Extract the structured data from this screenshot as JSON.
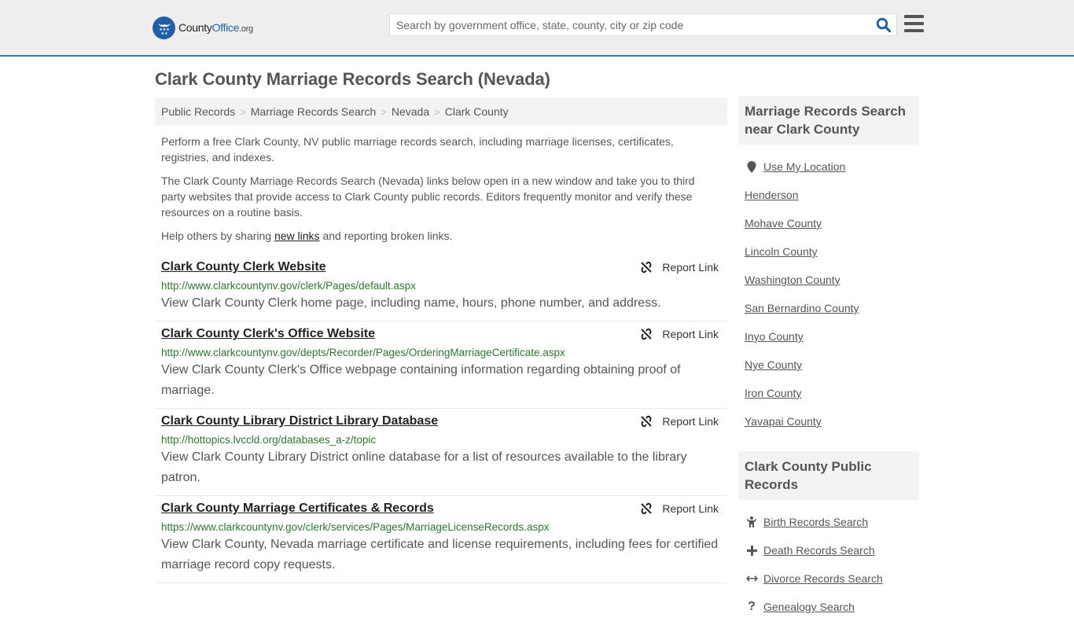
{
  "header": {
    "logo": {
      "name": "County",
      "name_bold": "Office",
      "tld": ".org"
    },
    "search": {
      "placeholder": "Search by government office, state, county, city or zip code",
      "value": ""
    },
    "brand_color": "#1f5fa8",
    "border_color": "#357ab7"
  },
  "page": {
    "title": "Clark County Marriage Records Search (Nevada)",
    "breadcrumb": [
      "Public Records",
      "Marriage Records Search",
      "Nevada",
      "Clark County"
    ],
    "breadcrumb_sep": ">",
    "intro": {
      "p1": "Perform a free Clark County, NV public marriage records search, including marriage licenses, certificates, registries, and indexes.",
      "p2": "The Clark County Marriage Records Search (Nevada) links below open in a new window and take you to third party websites that provide access to Clark County public records. Editors frequently monitor and verify these resources on a routine basis.",
      "p3_before": "Help others by sharing ",
      "p3_link": "new links",
      "p3_after": " and reporting broken links."
    }
  },
  "results": [
    {
      "title": "Clark County Clerk Website",
      "url": "http://www.clarkcountynv.gov/clerk/Pages/default.aspx",
      "description": "View Clark County Clerk home page, including name, hours, phone number, and address.",
      "report_label": "Report Link"
    },
    {
      "title": "Clark County Clerk's Office Website",
      "url": "http://www.clarkcountynv.gov/depts/Recorder/Pages/OrderingMarriageCertificate.aspx",
      "description": "View Clark County Clerk's Office webpage containing information regarding obtaining proof of marriage.",
      "report_label": "Report Link"
    },
    {
      "title": "Clark County Library District Library Database",
      "url": "http://hottopics.lvccld.org/databases_a-z/topic",
      "description": "View Clark County Library District online database for a list of resources available to the library patron.",
      "report_label": "Report Link"
    },
    {
      "title": "Clark County Marriage Certificates & Records",
      "url": "https://www.clarkcountynv.gov/clerk/services/Pages/MarriageLicenseRecords.aspx",
      "description": "View Clark County, Nevada marriage certificate and license requirements, including fees for certified marriage record copy requests.",
      "report_label": "Report Link"
    }
  ],
  "sidebar": {
    "nearby": {
      "heading": "Marriage Records Search near Clark County",
      "use_location": "Use My Location",
      "items": [
        "Henderson",
        "Mohave County",
        "Lincoln County",
        "Washington County",
        "San Bernardino County",
        "Inyo County",
        "Nye County",
        "Iron County",
        "Yavapai County"
      ]
    },
    "public_records": {
      "heading": "Clark County Public Records",
      "items": [
        {
          "label": "Birth Records Search",
          "icon": "child-icon"
        },
        {
          "label": "Death Records Search",
          "icon": "plus-icon"
        },
        {
          "label": "Divorce Records Search",
          "icon": "arrows-horizontal-icon"
        },
        {
          "label": "Genealogy Search",
          "icon": "question-icon"
        }
      ]
    }
  }
}
